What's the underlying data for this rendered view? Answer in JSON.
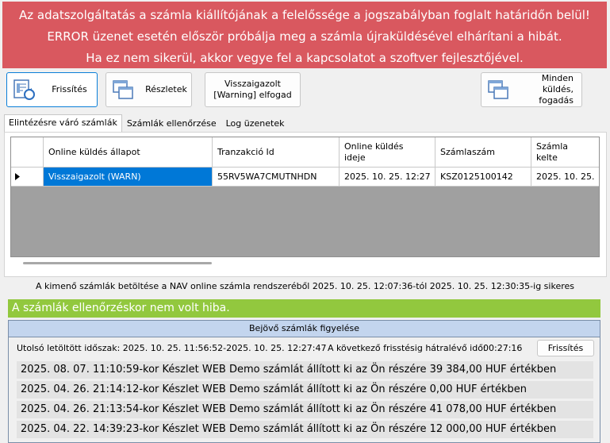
{
  "banner": {
    "lines": [
      "Az adatszolgáltatás a számla kiállítójának a felelőssége a jogszabályban foglalt határidőn belül!",
      "ERROR üzenet esetén először próbálja meg a számla újraküldésével elhárítani a hibát.",
      "Ha ez nem sikerül, akkor vegye fel a kapcsolatot a szoftver fejlesztőjével."
    ],
    "color": "#d9585f"
  },
  "toolbar": {
    "refresh_label": "Frissítés",
    "details_label": "Részletek",
    "accept_warning_label_1": "Visszaigazolt",
    "accept_warning_label_2": "[Warning] elfogad",
    "all_send_label_1": "Minden küldés,",
    "all_send_label_2": "fogadás"
  },
  "tabs": [
    {
      "label": "Elintézésre váró számlák",
      "selected": true
    },
    {
      "label": "Számlák ellenőrzése",
      "selected": false
    },
    {
      "label": "Log üzenetek",
      "selected": false
    }
  ],
  "grid": {
    "columns": [
      "Online küldés állapot",
      "Tranzakció Id",
      "Online küldés\nideje",
      "Számlaszám",
      "Számla\nkelte"
    ],
    "rows": [
      {
        "status": "Visszaigazolt (WARN)",
        "transaction_id": "55RV5WA7CMUTNHDN",
        "sent_time": "2025. 10. 25. 12:27",
        "invoice_number": "KSZ0125100142",
        "invoice_date": "2025. 10. 25."
      }
    ],
    "selection_color": "#0078d7"
  },
  "status_text": "A kimenő számlák betöltése a NAV online számla rendszeréből 2025. 10. 25. 12:07:36-tól 2025. 10. 25. 12:30:35-ig sikeres",
  "check_result": {
    "text": "A számlák ellenőrzéskor nem volt hiba.",
    "color": "#92c83e"
  },
  "incoming": {
    "title": "Bejövő számlák figyelése",
    "last_period": "Utolsó letöltött időszak: 2025. 10. 25. 11:56:52-2025. 10. 25. 12:27:47",
    "next_refresh_label": "A következő frisstésig hátralévő idő:",
    "next_refresh_value": "00:27:16",
    "refresh_label": "Frissítés",
    "items": [
      "2025. 08. 07. 11:10:59-kor Készlet WEB Demo számlát állított ki az Ön részére 39 384,00 HUF értékben",
      "2025. 04. 26. 21:14:12-kor Készlet WEB Demo számlát állított ki az Ön részére 0,00 HUF értékben",
      "2025. 04. 26. 21:13:54-kor Készlet WEB Demo számlát állított ki az Ön részére 41 078,00 HUF értékben",
      "2025. 04. 22. 14:39:23-kor Készlet WEB Demo számlát állított ki az Ön részére 12 000,00 HUF értékben"
    ]
  }
}
